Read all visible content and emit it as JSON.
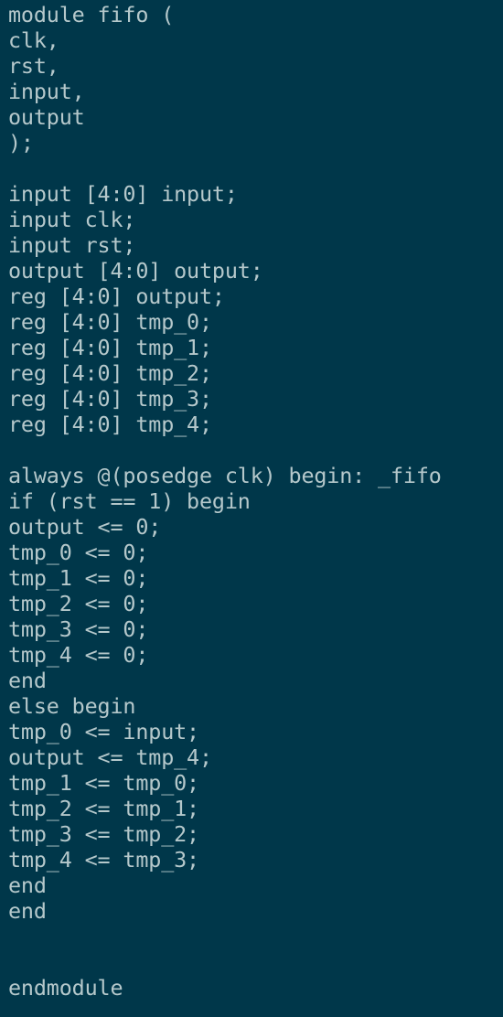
{
  "terminal": {
    "colors": {
      "background": "#00374a",
      "text": "#b5c8cb"
    },
    "lines": [
      "module fifo (",
      "clk,",
      "rst,",
      "input,",
      "output",
      ");",
      "",
      "input [4:0] input;",
      "input clk;",
      "input rst;",
      "output [4:0] output;",
      "reg [4:0] output;",
      "reg [4:0] tmp_0;",
      "reg [4:0] tmp_1;",
      "reg [4:0] tmp_2;",
      "reg [4:0] tmp_3;",
      "reg [4:0] tmp_4;",
      "",
      "always @(posedge clk) begin: _fifo",
      "if (rst == 1) begin",
      "output <= 0;",
      "tmp_0 <= 0;",
      "tmp_1 <= 0;",
      "tmp_2 <= 0;",
      "tmp_3 <= 0;",
      "tmp_4 <= 0;",
      "end",
      "else begin",
      "tmp_0 <= input;",
      "output <= tmp_4;",
      "tmp_1 <= tmp_0;",
      "tmp_2 <= tmp_1;",
      "tmp_3 <= tmp_2;",
      "tmp_4 <= tmp_3;",
      "end",
      "end",
      "",
      "",
      "endmodule"
    ]
  }
}
